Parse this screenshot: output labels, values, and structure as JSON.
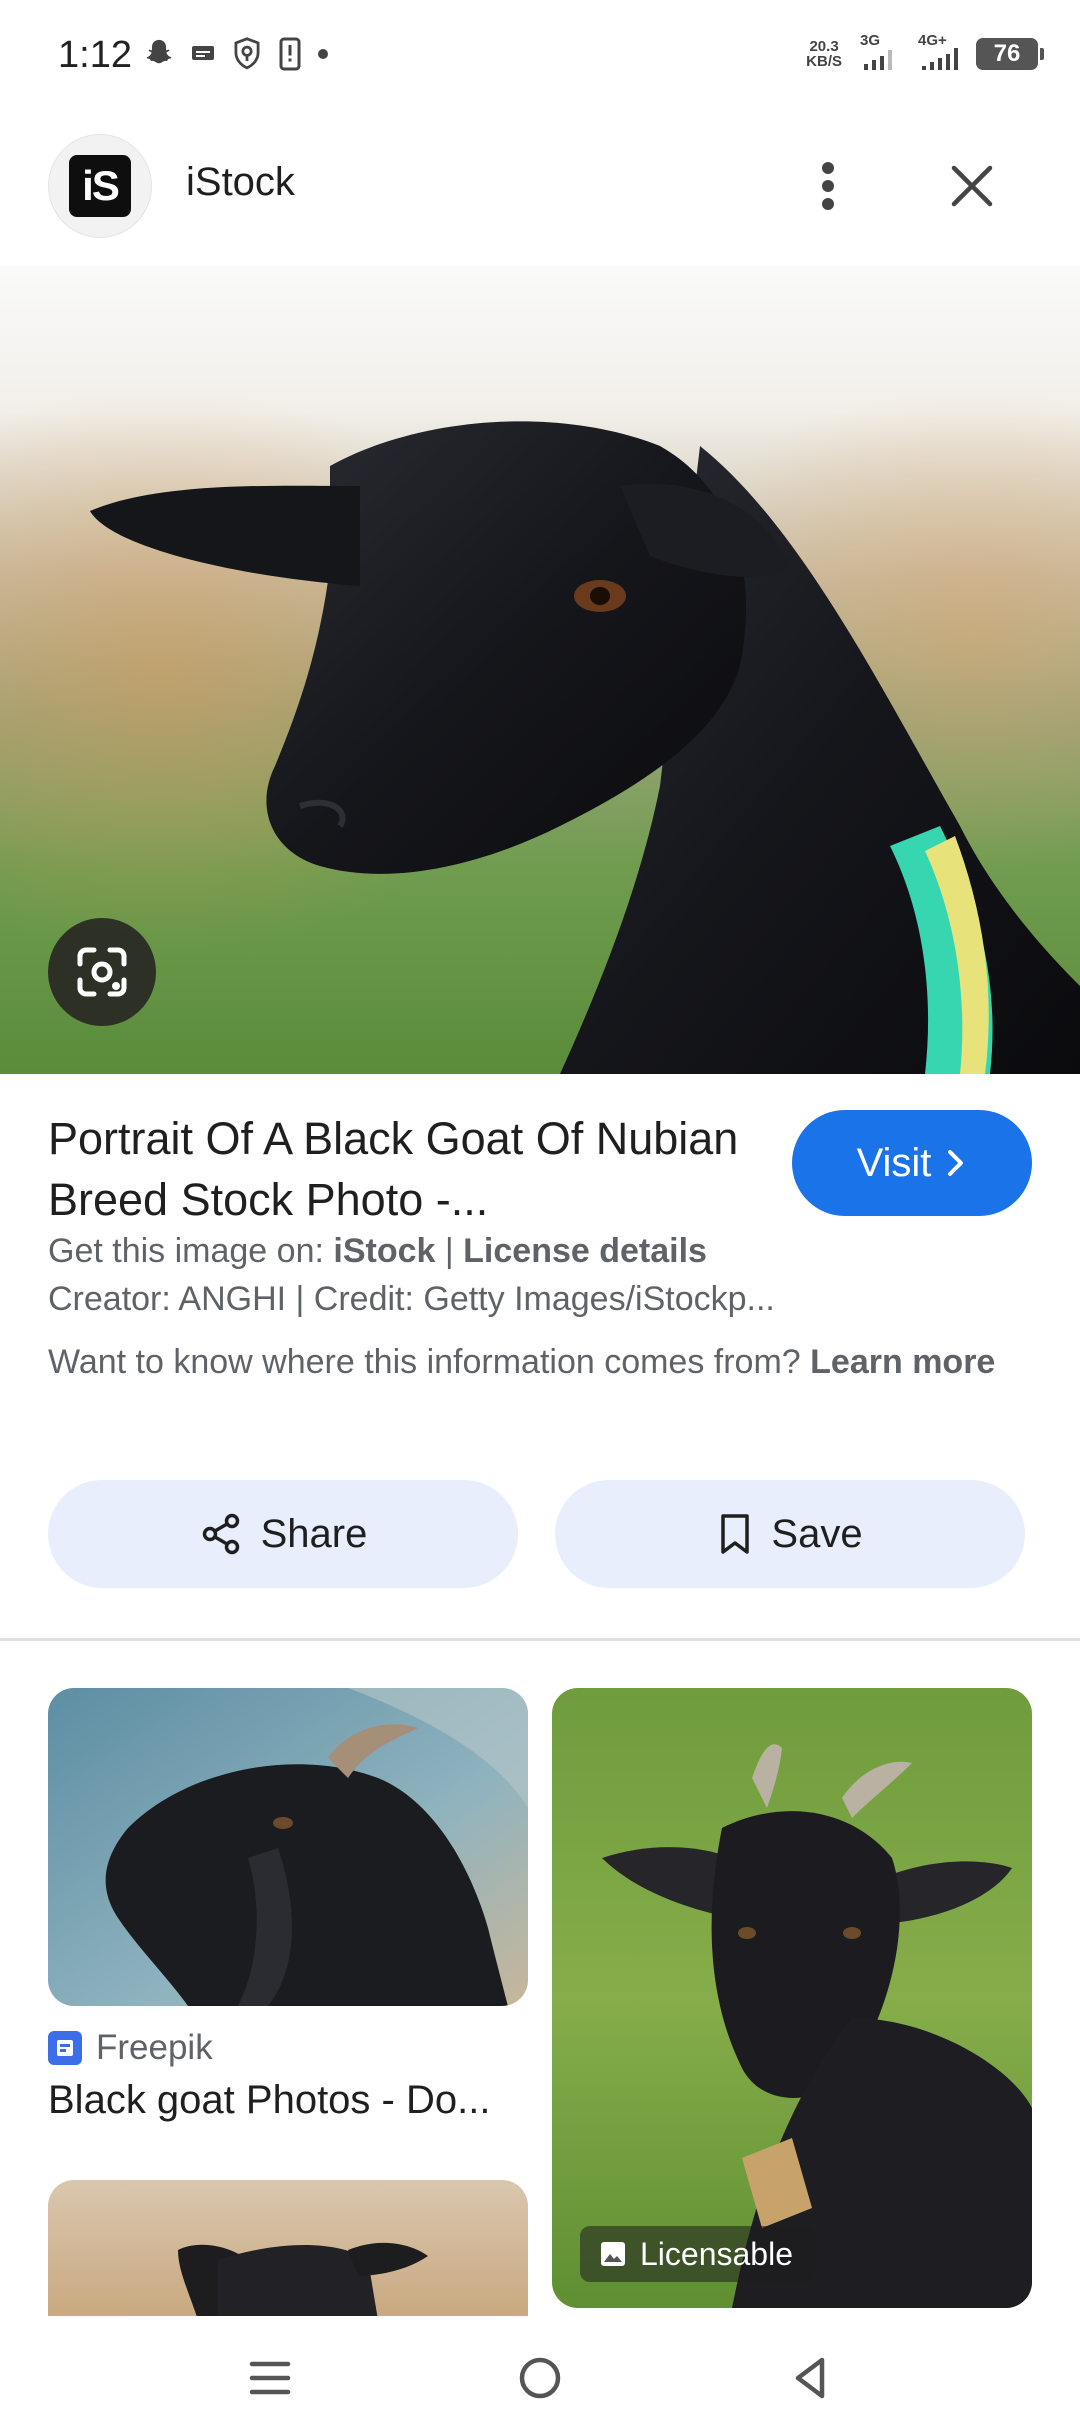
{
  "status_bar": {
    "time": "1:12",
    "net_speed_value": "20.3",
    "net_speed_unit": "KB/S",
    "signal1_label": "3G",
    "signal2_label": "4G+",
    "battery": "76"
  },
  "header": {
    "logo_text": "iS",
    "site_name": "iStock"
  },
  "result": {
    "title": "Portrait Of A Black Goat Of Nubian Breed Stock Photo -...",
    "visit_label": "Visit",
    "source_prefix": "Get this image on: ",
    "source_name": "iStock",
    "separator": " | ",
    "license_label": "License details",
    "credit": "Creator: ANGHI | Credit: Getty Images/iStockp...",
    "info_question": "Want to know where this information comes from? ",
    "learn_more": "Learn more"
  },
  "actions": {
    "share_label": "Share",
    "save_label": "Save"
  },
  "related": [
    {
      "source": "Freepik",
      "title": "Black goat Photos - Do..."
    },
    {
      "badge": "Licensable"
    }
  ],
  "icons": {
    "more": "more-vert-icon",
    "close": "close-icon",
    "lens": "google-lens-icon",
    "share": "share-icon",
    "save": "bookmark-icon",
    "licensable": "image-icon",
    "nav_menu": "recents-icon",
    "nav_home": "home-icon",
    "nav_back": "back-icon"
  },
  "colors": {
    "visit_bg": "#1a73e8",
    "action_bg": "#e8eefb",
    "secondary_text": "#5f6368",
    "favicon": "#3b6ee8"
  }
}
